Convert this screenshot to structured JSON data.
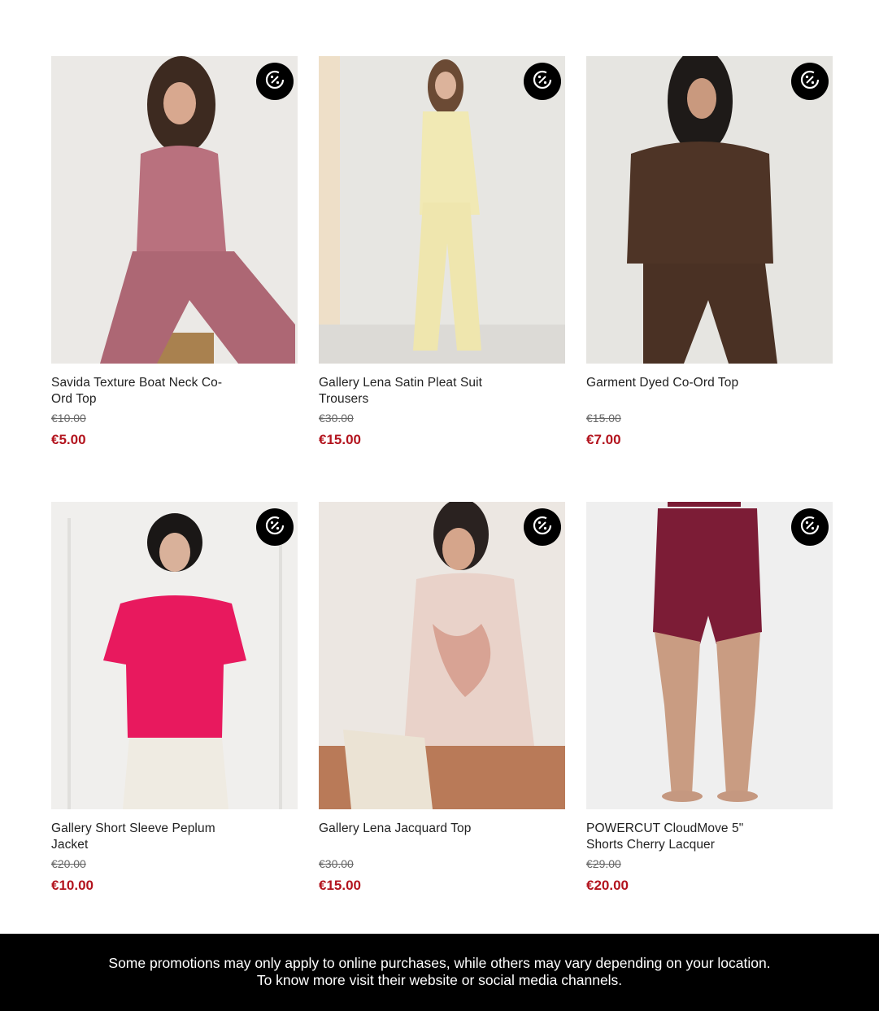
{
  "products": [
    {
      "name": "Savida Texture Boat Neck Co-Ord Top",
      "was_price": "€10.00",
      "price": "€5.00",
      "badge_icon": "discount-cycle-icon"
    },
    {
      "name": "Gallery Lena Satin Pleat Suit Trousers",
      "was_price": "€30.00",
      "price": "€15.00",
      "badge_icon": "discount-cycle-icon"
    },
    {
      "name": "Garment Dyed Co-Ord Top",
      "was_price": "€15.00",
      "price": "€7.00",
      "badge_icon": "discount-cycle-icon"
    },
    {
      "name": "Gallery Short Sleeve Peplum Jacket",
      "was_price": "€20.00",
      "price": "€10.00",
      "badge_icon": "discount-cycle-icon"
    },
    {
      "name": "Gallery Lena Jacquard Top",
      "was_price": "€30.00",
      "price": "€15.00",
      "badge_icon": "discount-cycle-icon"
    },
    {
      "name": "POWERCUT CloudMove 5\" Shorts Cherry Lacquer",
      "was_price": "€29.00",
      "price": "€20.00",
      "badge_icon": "discount-cycle-icon"
    }
  ],
  "footer": {
    "line1": "Some promotions may only apply to online purchases, while others may vary depending on your location.",
    "line2": "To know more visit their website or social media channels."
  },
  "colors": {
    "sale_price": "#b3141e",
    "badge_bg": "#000000",
    "footer_bg": "#000000"
  }
}
